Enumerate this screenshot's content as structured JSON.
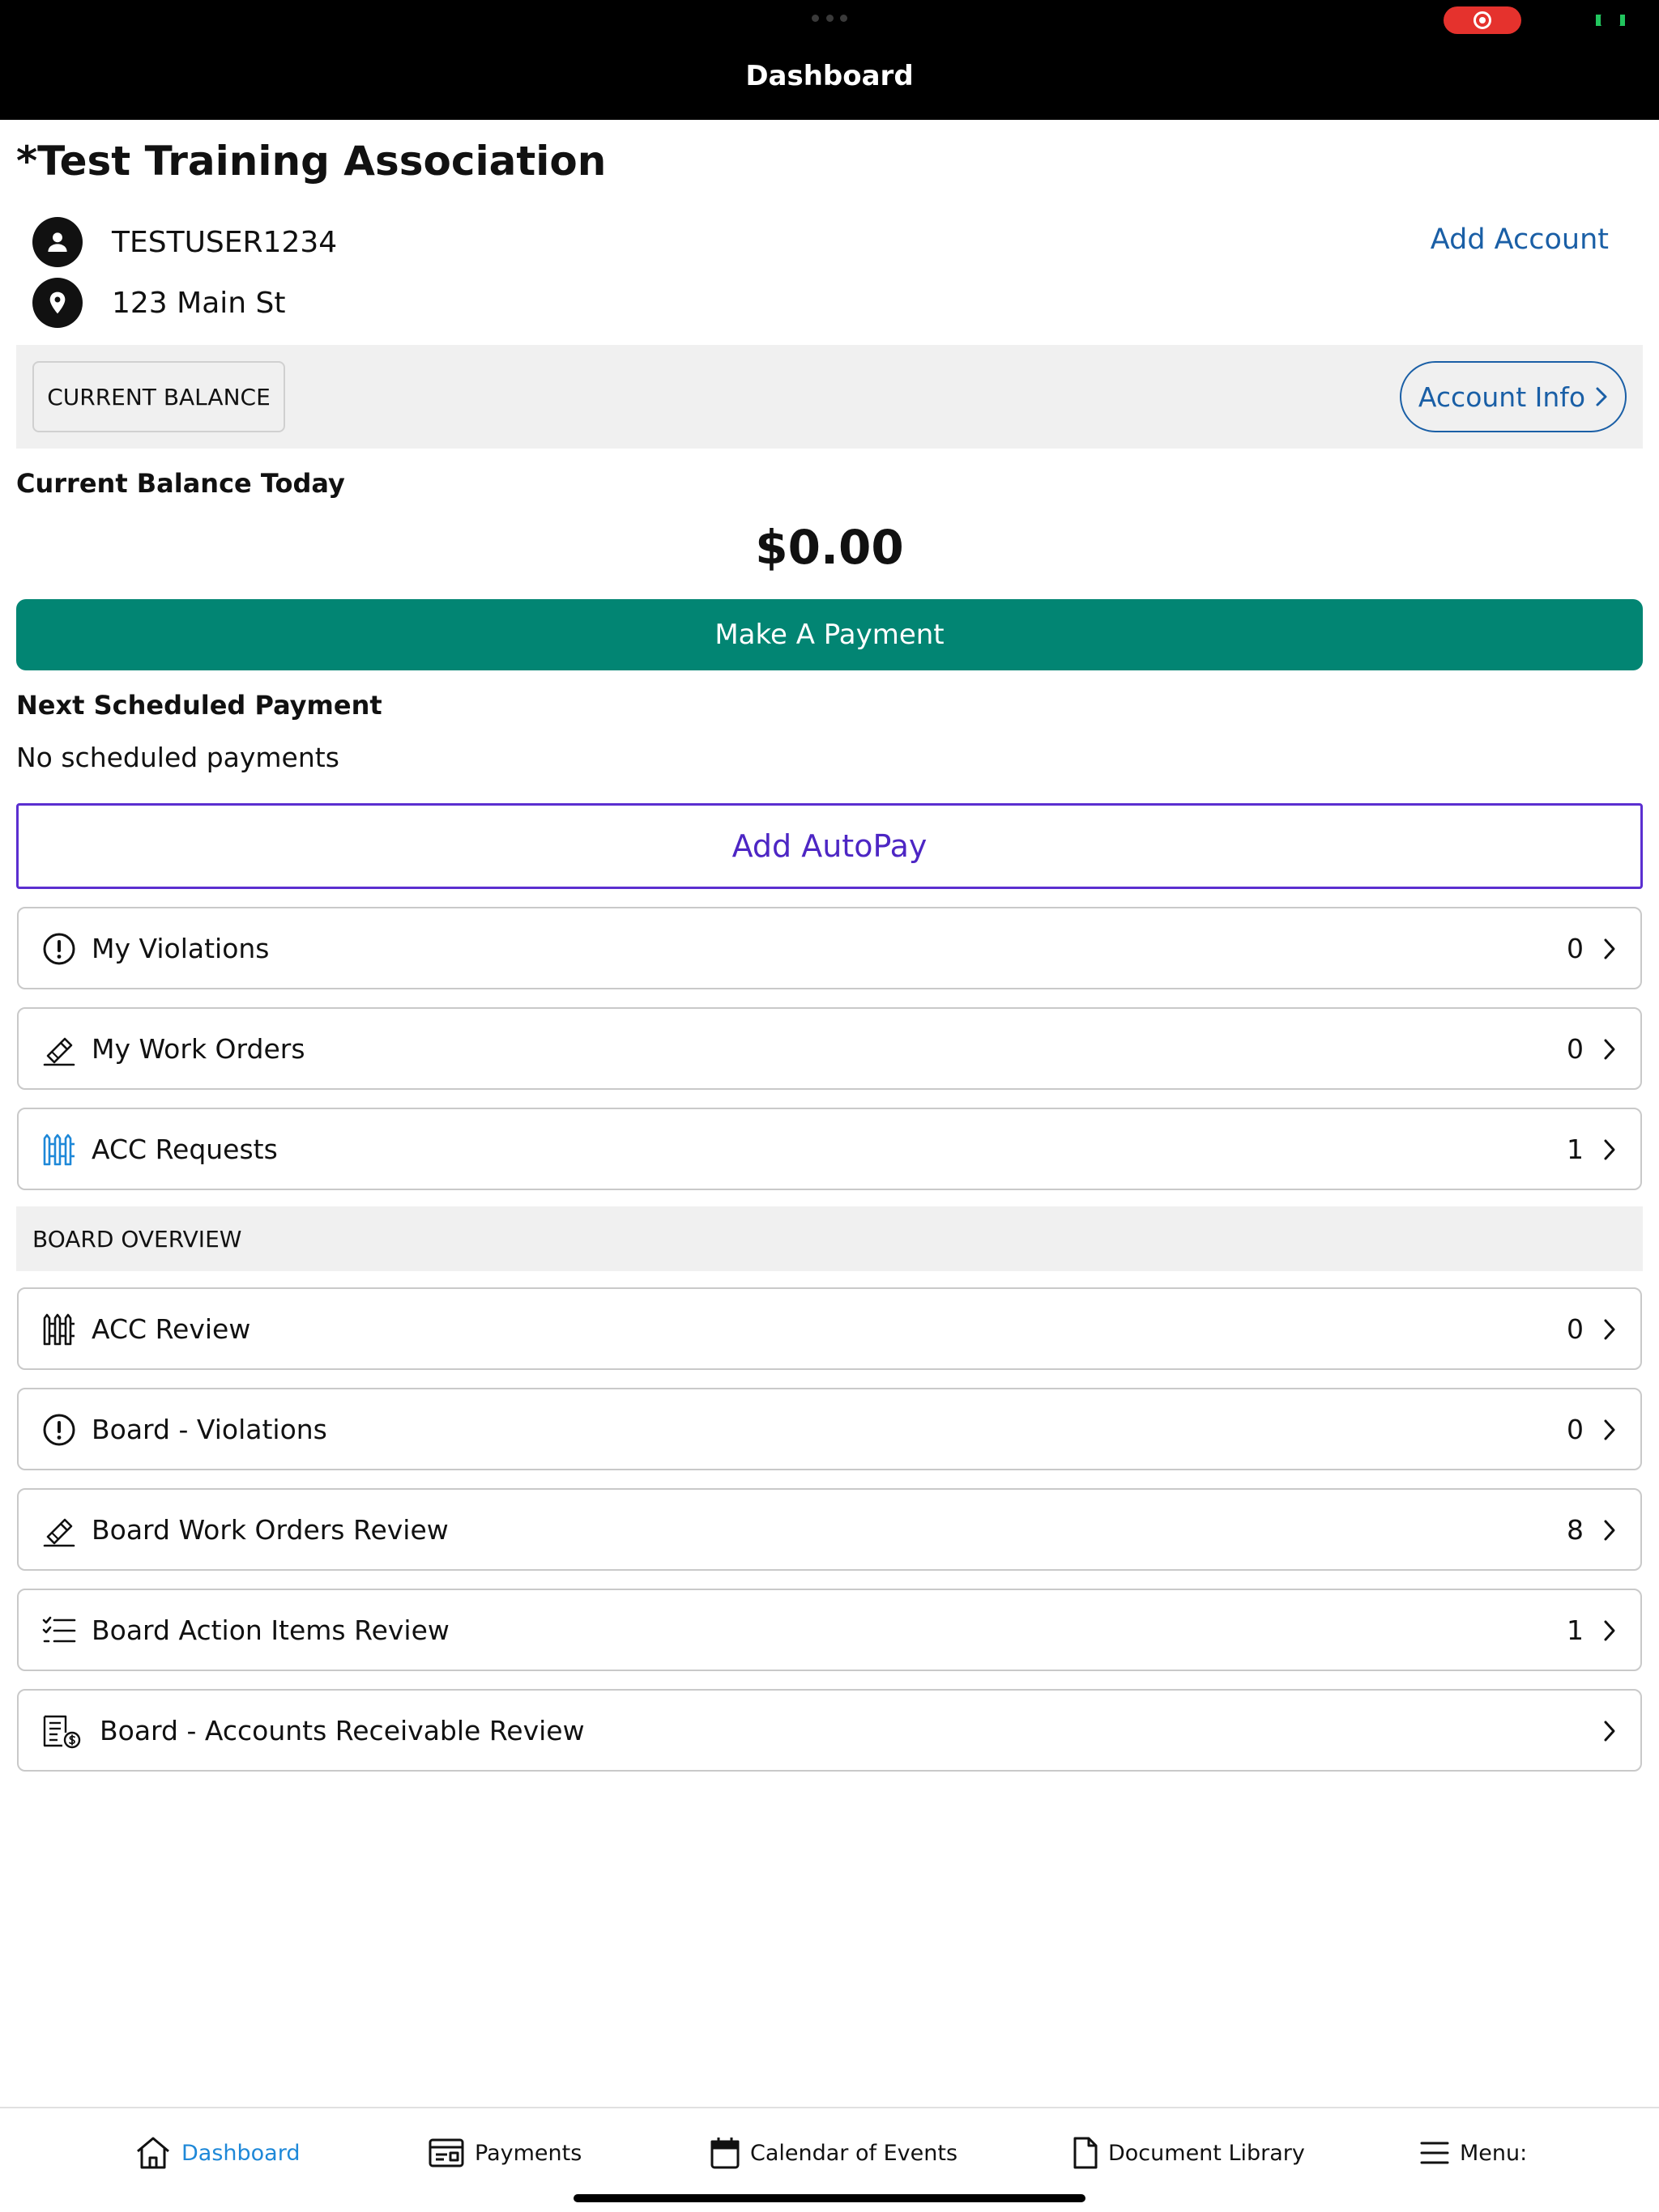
{
  "topbar": {
    "title": "Dashboard"
  },
  "header": {
    "association": "*Test Training Association",
    "username": "TESTUSER1234",
    "address": "123 Main St",
    "add_account": "Add Account"
  },
  "balance": {
    "tab_label": "CURRENT BALANCE",
    "account_info": "Account Info",
    "label": "Current Balance Today",
    "amount": "$0.00",
    "pay_button": "Make A Payment"
  },
  "scheduled": {
    "label": "Next Scheduled Payment",
    "value": "No scheduled payments",
    "autopay_button": "Add AutoPay"
  },
  "my_items": [
    {
      "label": "My Violations",
      "count": "0",
      "icon": "exclamation-circle-icon"
    },
    {
      "label": "My Work Orders",
      "count": "0",
      "icon": "hammer-icon"
    },
    {
      "label": "ACC Requests",
      "count": "1",
      "icon": "fence-icon"
    }
  ],
  "board": {
    "header": "BOARD OVERVIEW",
    "items": [
      {
        "label": "ACC Review",
        "count": "0",
        "icon": "fence-icon"
      },
      {
        "label": "Board - Violations",
        "count": "0",
        "icon": "exclamation-circle-icon"
      },
      {
        "label": "Board Work Orders Review",
        "count": "8",
        "icon": "hammer-icon"
      },
      {
        "label": "Board Action Items Review",
        "count": "1",
        "icon": "checklist-icon"
      },
      {
        "label": "Board - Accounts Receivable Review",
        "count": "",
        "icon": "receivable-icon"
      }
    ]
  },
  "nav": {
    "dashboard": "Dashboard",
    "payments": "Payments",
    "calendar": "Calendar of Events",
    "documents": "Document Library",
    "menu": "Menu:"
  },
  "colors": {
    "pay_button": "#028573",
    "link_blue": "#1a5fa6",
    "autopay_purple": "#5b2fd0",
    "nav_active": "#1e88d8",
    "acc_request_icon": "#1e88d8"
  }
}
